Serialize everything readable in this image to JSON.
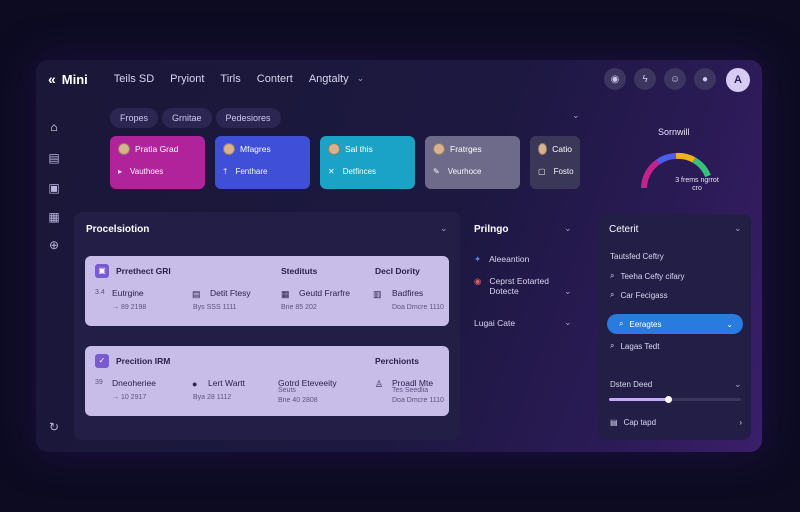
{
  "header": {
    "app_name": "Mini",
    "nav": [
      "Teils SD",
      "Pryiont",
      "Tirls",
      "Contert",
      "Angtalty"
    ]
  },
  "toolbar_icons": [
    "settings-icon",
    "bolt-icon",
    "chat-icon",
    "notification-icon"
  ],
  "avatar_initial": "A",
  "sidebar_icons": [
    "home-icon",
    "list-icon",
    "folder-icon",
    "box-icon",
    "globe-icon",
    "refresh-icon"
  ],
  "filters": [
    "Fropes",
    "Grnitae",
    "Pedesiores"
  ],
  "cards": [
    {
      "title": "Pratia Grad",
      "sub": "Vauthoes",
      "color": "#b0239a"
    },
    {
      "title": "Mfagres",
      "sub": "Fenthare",
      "color": "#3f4fd8"
    },
    {
      "title": "Sal this",
      "sub": "Detfinces",
      "color": "#1aa3c7"
    },
    {
      "title": "Fratrges",
      "sub": "Veurhoce",
      "color": "#6e6a8a"
    },
    {
      "title": "Catio",
      "sub": "Fosto",
      "color": "#3b3759"
    }
  ],
  "gauge": {
    "title": "Sornwill",
    "caption": "3 frems ngrrot",
    "caption2": "cro"
  },
  "procedure_panel": {
    "title": "Procelsiotion",
    "items": [
      {
        "heading": "Prrethect GRI",
        "col2_heading": "Stedituts",
        "col3_heading": "DecI Dority",
        "line1": "Eutrgine",
        "line1_prefix": "3.4",
        "line1_sub": "→ 89 2198",
        "c2a": "Detit Ftesy",
        "c2a_sub": "Bys SSS 1111",
        "c2b": "Geutd Frarfre",
        "c2b_sub": "Bne 85 202",
        "c3": "Badfires",
        "c3_sub": "Doa Dmcre 1110"
      },
      {
        "heading": "Precition IRM",
        "col3_heading": "Perchionts",
        "line1": "Dneoheriee",
        "line1_prefix": "39",
        "line1_sub": "→ 10 2917",
        "c2a": "Lert Wartt",
        "c2a_sub": "Bya 28 1112",
        "c2b": "Gotrd Eteveeity",
        "c2b_sub": "Seuts",
        "c2b_sub2": "Bne 40 2808",
        "c3": "Proadl Mte",
        "c3_sub": "Tes Seedlia",
        "c3_sub2": "Doa Dmcre 1110"
      }
    ]
  },
  "middle_panel": {
    "title": "Prilngo",
    "items": [
      {
        "label": "Aleeantion"
      },
      {
        "label": "Ceprst Eotarted",
        "sub": "Dotecte"
      },
      {
        "label": "Lugai Cate"
      }
    ]
  },
  "right_panel": {
    "title": "Ceterit",
    "items": [
      {
        "label": "Tautsfed Ceftry"
      },
      {
        "label": "Teeha Cefty cifary"
      },
      {
        "label": "Car Fecigass"
      }
    ],
    "selected": "Eeragtes",
    "item_after": "Lagas Tedt",
    "slider_label": "Dsten Deed",
    "slider_value": 0.45,
    "footer_item": "Cap tapd"
  }
}
